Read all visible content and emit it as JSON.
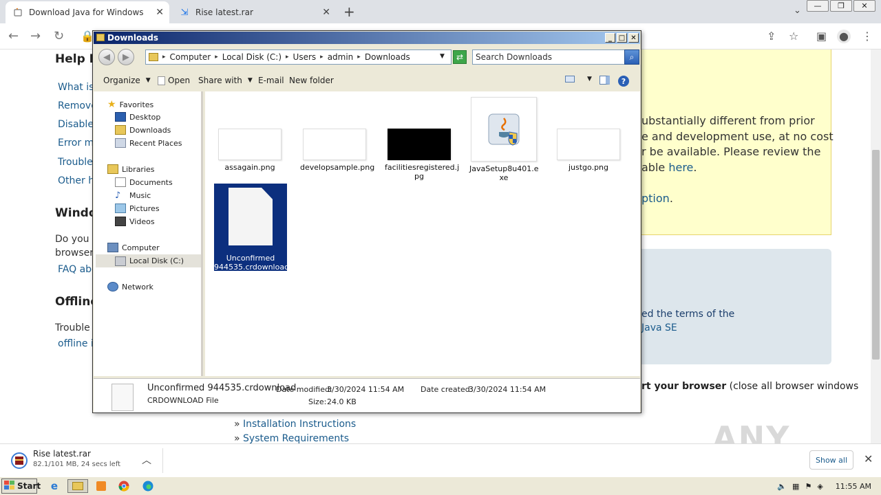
{
  "browser": {
    "tabs": [
      {
        "label": "Download Java for Windows",
        "icon": "java-icon"
      },
      {
        "label": "Rise latest.rar",
        "icon": "download-icon"
      }
    ]
  },
  "page": {
    "sidebar": {
      "help_heading": "Help R",
      "links": [
        "What is",
        "Remove",
        "Disable",
        "Error m",
        "Troubles",
        "Other he"
      ],
      "windows_heading": "Windo",
      "windows_text": [
        "Do you u",
        "browsers"
      ],
      "faq_link": "FAQ abo",
      "offline_heading": "Offline",
      "offline_text": "Trouble",
      "offline_link": "offline i"
    },
    "yellow_box": {
      "line1": "ubstantially different from prior",
      "line2": "e and development use, at no cost",
      "line3": "r be available. Please review the",
      "line4_text": "able ",
      "line4_link": "here",
      "line4_end": ".",
      "line5_link": "ption",
      "line5_end": "."
    },
    "blue_box": {
      "line1": "ed the terms of the",
      "line2": "Java SE"
    },
    "restart": {
      "bold": "rt your browser",
      "text": " (close all browser windows"
    },
    "install_links": [
      "Installation Instructions",
      "System Requirements"
    ],
    "watermark": "ANY RUN"
  },
  "download_bar": {
    "file_name": "Rise latest.rar",
    "progress_text": "82.1/101 MB, 24 secs left",
    "show_all": "Show all"
  },
  "taskbar": {
    "start_label": "Start",
    "clock": "11:55 AM"
  },
  "explorer": {
    "title": "Downloads",
    "breadcrumb": [
      "Computer",
      "Local Disk (C:)",
      "Users",
      "admin",
      "Downloads"
    ],
    "search_placeholder": "Search Downloads",
    "commands": {
      "organize": "Organize",
      "open": "Open",
      "share_with": "Share with",
      "email": "E-mail",
      "new_folder": "New folder"
    },
    "nav": {
      "favorites": "Favorites",
      "desktop": "Desktop",
      "downloads": "Downloads",
      "recent": "Recent Places",
      "libraries": "Libraries",
      "documents": "Documents",
      "music": "Music",
      "pictures": "Pictures",
      "videos": "Videos",
      "computer": "Computer",
      "local_disk": "Local Disk (C:)",
      "network": "Network"
    },
    "files": [
      {
        "name": "assagain.png"
      },
      {
        "name": "developsample.png"
      },
      {
        "name": "facilitiesregistered.jpg",
        "line1": "facilitiesregistered.j",
        "line2": "pg"
      },
      {
        "name": "JavaSetup8u401.exe",
        "line1": "JavaSetup8u401.e",
        "line2": "xe"
      },
      {
        "name": "justgo.png"
      },
      {
        "name": "Unconfirmed 944535.crdownload",
        "line1": "Unconfirmed",
        "line2": "944535.crdownload"
      }
    ],
    "details": {
      "file_name": "Unconfirmed 944535.crdownload",
      "file_type": "CRDOWNLOAD File",
      "modified_label": "Date modified:",
      "modified": "3/30/2024 11:54 AM",
      "created_label": "Date created:",
      "created": "3/30/2024 11:54 AM",
      "size_label": "Size:",
      "size": "24.0 KB"
    }
  }
}
